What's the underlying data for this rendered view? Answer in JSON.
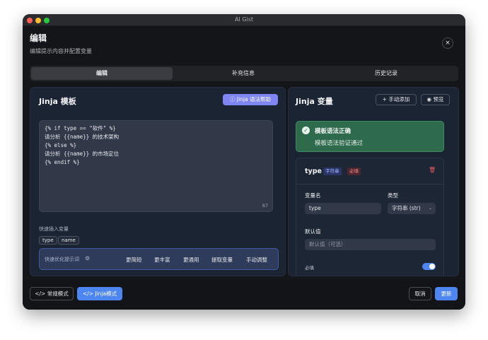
{
  "window": {
    "title": "AI Gist"
  },
  "dialog": {
    "title": "编辑",
    "subtitle": "编辑提示内容并配置变量",
    "close_glyph": "×"
  },
  "tabs": [
    {
      "label": "编辑",
      "active": true
    },
    {
      "label": "补充信息",
      "active": false
    },
    {
      "label": "历史记录",
      "active": false
    }
  ],
  "left_panel": {
    "title": "Jinja 模板",
    "help_button": "Jinja 语法帮助",
    "editor_lines": [
      "{% if type == \"软件\" %}",
      "请分析 {{name}} 的技术架构",
      "{% else %}",
      "请分析 {{name}} 的市场定位",
      "{% endif %}"
    ],
    "char_count": "87",
    "quick_insert_label": "快速插入变量",
    "variables": [
      "type",
      "name"
    ],
    "optimize": {
      "label": "快速优化提示词",
      "actions": [
        "更简短",
        "更丰富",
        "更通用",
        "提取变量",
        "手动调整"
      ]
    }
  },
  "right_panel": {
    "title": "Jinja 变量",
    "add_button": "手动添加",
    "preview_button": "预览",
    "status": {
      "title": "模板语法正确",
      "message": "模板语法验证通过",
      "color": "#2e6a4c"
    },
    "variable": {
      "name": "type",
      "type_badge": "字符串",
      "required_badge": "必填",
      "name_label": "变量名",
      "name_value": "type",
      "type_label": "类型",
      "type_value": "字符串 (str)",
      "default_label": "默认值",
      "default_placeholder": "默认值（可选）",
      "required_label": "必填",
      "required_on": true
    }
  },
  "footer": {
    "normal_mode": "常规模式",
    "jinja_mode": "Jinja模式",
    "cancel": "取消",
    "update": "更新"
  },
  "colors": {
    "accent": "#4d86f0",
    "help": "#7f86f4",
    "success": "#2e6a4c"
  }
}
